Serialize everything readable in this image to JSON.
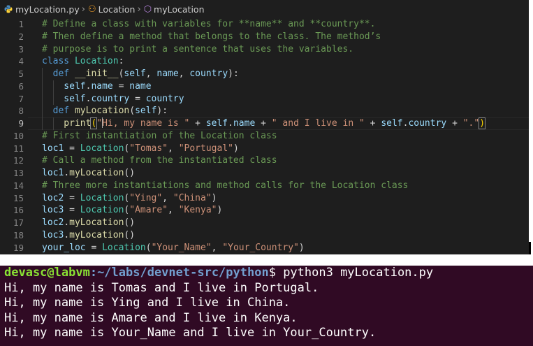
{
  "breadcrumb": {
    "file": "myLocation.py",
    "class": "Location",
    "method": "myLocation"
  },
  "editor": {
    "current_line": 9,
    "lines": [
      {
        "n": 1,
        "indent": 0,
        "tokens": [
          {
            "t": "# Define a class with variables for **name** and **country**.",
            "c": "cm"
          }
        ]
      },
      {
        "n": 2,
        "indent": 0,
        "tokens": [
          {
            "t": "# Then define a method that belongs to the class. The method’s",
            "c": "cm"
          }
        ]
      },
      {
        "n": 3,
        "indent": 0,
        "tokens": [
          {
            "t": "# purpose is to print a sentence that uses the variables.",
            "c": "cm"
          }
        ]
      },
      {
        "n": 4,
        "indent": 0,
        "tokens": [
          {
            "t": "class ",
            "c": "kw"
          },
          {
            "t": "Location",
            "c": "cl"
          },
          {
            "t": ":",
            "c": "pn"
          }
        ]
      },
      {
        "n": 5,
        "indent": 1,
        "tokens": [
          {
            "t": "  def ",
            "c": "kw"
          },
          {
            "t": "__init__",
            "c": "fn"
          },
          {
            "t": "(",
            "c": "pn"
          },
          {
            "t": "self",
            "c": "vr"
          },
          {
            "t": ", ",
            "c": "pn"
          },
          {
            "t": "name",
            "c": "vr"
          },
          {
            "t": ", ",
            "c": "pn"
          },
          {
            "t": "country",
            "c": "vr"
          },
          {
            "t": "):",
            "c": "pn"
          }
        ]
      },
      {
        "n": 6,
        "indent": 2,
        "tokens": [
          {
            "t": "    self",
            "c": "vr"
          },
          {
            "t": ".",
            "c": "pn"
          },
          {
            "t": "name",
            "c": "vr"
          },
          {
            "t": " = ",
            "c": "pn"
          },
          {
            "t": "name",
            "c": "vr"
          }
        ]
      },
      {
        "n": 7,
        "indent": 2,
        "tokens": [
          {
            "t": "    self",
            "c": "vr"
          },
          {
            "t": ".",
            "c": "pn"
          },
          {
            "t": "country",
            "c": "vr"
          },
          {
            "t": " = ",
            "c": "pn"
          },
          {
            "t": "country",
            "c": "vr"
          }
        ]
      },
      {
        "n": 8,
        "indent": 1,
        "tokens": [
          {
            "t": "  def ",
            "c": "kw"
          },
          {
            "t": "myLocation",
            "c": "fn"
          },
          {
            "t": "(",
            "c": "pn"
          },
          {
            "t": "self",
            "c": "vr"
          },
          {
            "t": "):",
            "c": "pn"
          }
        ]
      },
      {
        "n": 9,
        "indent": 2,
        "tokens": [
          {
            "t": "    print",
            "c": "fn"
          },
          {
            "t": "(",
            "c": "br1 bm"
          },
          {
            "t": "\"",
            "c": "st"
          },
          {
            "t": "|",
            "c": "cursor"
          },
          {
            "t": "Hi, my name is \"",
            "c": "st"
          },
          {
            "t": " + ",
            "c": "pn"
          },
          {
            "t": "self",
            "c": "vr"
          },
          {
            "t": ".",
            "c": "pn"
          },
          {
            "t": "name",
            "c": "vr"
          },
          {
            "t": " + ",
            "c": "pn"
          },
          {
            "t": "\" and I live in \"",
            "c": "st"
          },
          {
            "t": " + ",
            "c": "pn"
          },
          {
            "t": "self",
            "c": "vr"
          },
          {
            "t": ".",
            "c": "pn"
          },
          {
            "t": "country",
            "c": "vr"
          },
          {
            "t": " + ",
            "c": "pn"
          },
          {
            "t": "\".\"",
            "c": "st"
          },
          {
            "t": ")",
            "c": "br1 bm"
          }
        ]
      },
      {
        "n": 10,
        "indent": 0,
        "tokens": [
          {
            "t": "# First instantiation of the Location class",
            "c": "cm"
          }
        ]
      },
      {
        "n": 11,
        "indent": 0,
        "tokens": [
          {
            "t": "loc1",
            "c": "vr"
          },
          {
            "t": " = ",
            "c": "pn"
          },
          {
            "t": "Location",
            "c": "cl"
          },
          {
            "t": "(",
            "c": "pn"
          },
          {
            "t": "\"Tomas\"",
            "c": "st"
          },
          {
            "t": ", ",
            "c": "pn"
          },
          {
            "t": "\"Portugal\"",
            "c": "st"
          },
          {
            "t": ")",
            "c": "pn"
          }
        ]
      },
      {
        "n": 12,
        "indent": 0,
        "tokens": [
          {
            "t": "# Call a method from the instantiated class",
            "c": "cm"
          }
        ]
      },
      {
        "n": 13,
        "indent": 0,
        "tokens": [
          {
            "t": "loc1",
            "c": "vr"
          },
          {
            "t": ".",
            "c": "pn"
          },
          {
            "t": "myLocation",
            "c": "fn"
          },
          {
            "t": "()",
            "c": "pn"
          }
        ]
      },
      {
        "n": 14,
        "indent": 0,
        "tokens": [
          {
            "t": "# Three more instantiations and method calls for the Location class",
            "c": "cm"
          }
        ]
      },
      {
        "n": 15,
        "indent": 0,
        "tokens": [
          {
            "t": "loc2",
            "c": "vr"
          },
          {
            "t": " = ",
            "c": "pn"
          },
          {
            "t": "Location",
            "c": "cl"
          },
          {
            "t": "(",
            "c": "pn"
          },
          {
            "t": "\"Ying\"",
            "c": "st"
          },
          {
            "t": ", ",
            "c": "pn"
          },
          {
            "t": "\"China\"",
            "c": "st"
          },
          {
            "t": ")",
            "c": "pn"
          }
        ]
      },
      {
        "n": 16,
        "indent": 0,
        "tokens": [
          {
            "t": "loc3",
            "c": "vr"
          },
          {
            "t": " = ",
            "c": "pn"
          },
          {
            "t": "Location",
            "c": "cl"
          },
          {
            "t": "(",
            "c": "pn"
          },
          {
            "t": "\"Amare\"",
            "c": "st"
          },
          {
            "t": ", ",
            "c": "pn"
          },
          {
            "t": "\"Kenya\"",
            "c": "st"
          },
          {
            "t": ")",
            "c": "pn"
          }
        ]
      },
      {
        "n": 17,
        "indent": 0,
        "tokens": [
          {
            "t": "loc2",
            "c": "vr"
          },
          {
            "t": ".",
            "c": "pn"
          },
          {
            "t": "myLocation",
            "c": "fn"
          },
          {
            "t": "()",
            "c": "pn"
          }
        ]
      },
      {
        "n": 18,
        "indent": 0,
        "tokens": [
          {
            "t": "loc3",
            "c": "vr"
          },
          {
            "t": ".",
            "c": "pn"
          },
          {
            "t": "myLocation",
            "c": "fn"
          },
          {
            "t": "()",
            "c": "pn"
          }
        ]
      },
      {
        "n": 19,
        "indent": 0,
        "tokens": [
          {
            "t": "your_loc",
            "c": "vr"
          },
          {
            "t": " = ",
            "c": "pn"
          },
          {
            "t": "Location",
            "c": "cl"
          },
          {
            "t": "(",
            "c": "pn"
          },
          {
            "t": "\"Your_Name\"",
            "c": "st"
          },
          {
            "t": ", ",
            "c": "pn"
          },
          {
            "t": "\"Your_Country\"",
            "c": "st"
          },
          {
            "t": ")",
            "c": "pn"
          }
        ]
      }
    ]
  },
  "terminal": {
    "prompt_user": "devasc@labvm",
    "prompt_path": ":~/labs/devnet-src/python",
    "prompt_symbol": "$ ",
    "command": "python3 myLocation.py",
    "output": [
      "Hi, my name is Tomas and I live in Portugal.",
      "Hi, my name is Ying and I live in China.",
      "Hi, my name is Amare and I live in Kenya.",
      "Hi, my name is Your_Name and I live in Your_Country."
    ]
  },
  "colors": {
    "editor_bg": "#1e1e1e",
    "terminal_bg": "#300a24",
    "comment": "#6a9955",
    "keyword": "#569cd6",
    "string": "#ce9178",
    "class": "#4ec9b0"
  }
}
